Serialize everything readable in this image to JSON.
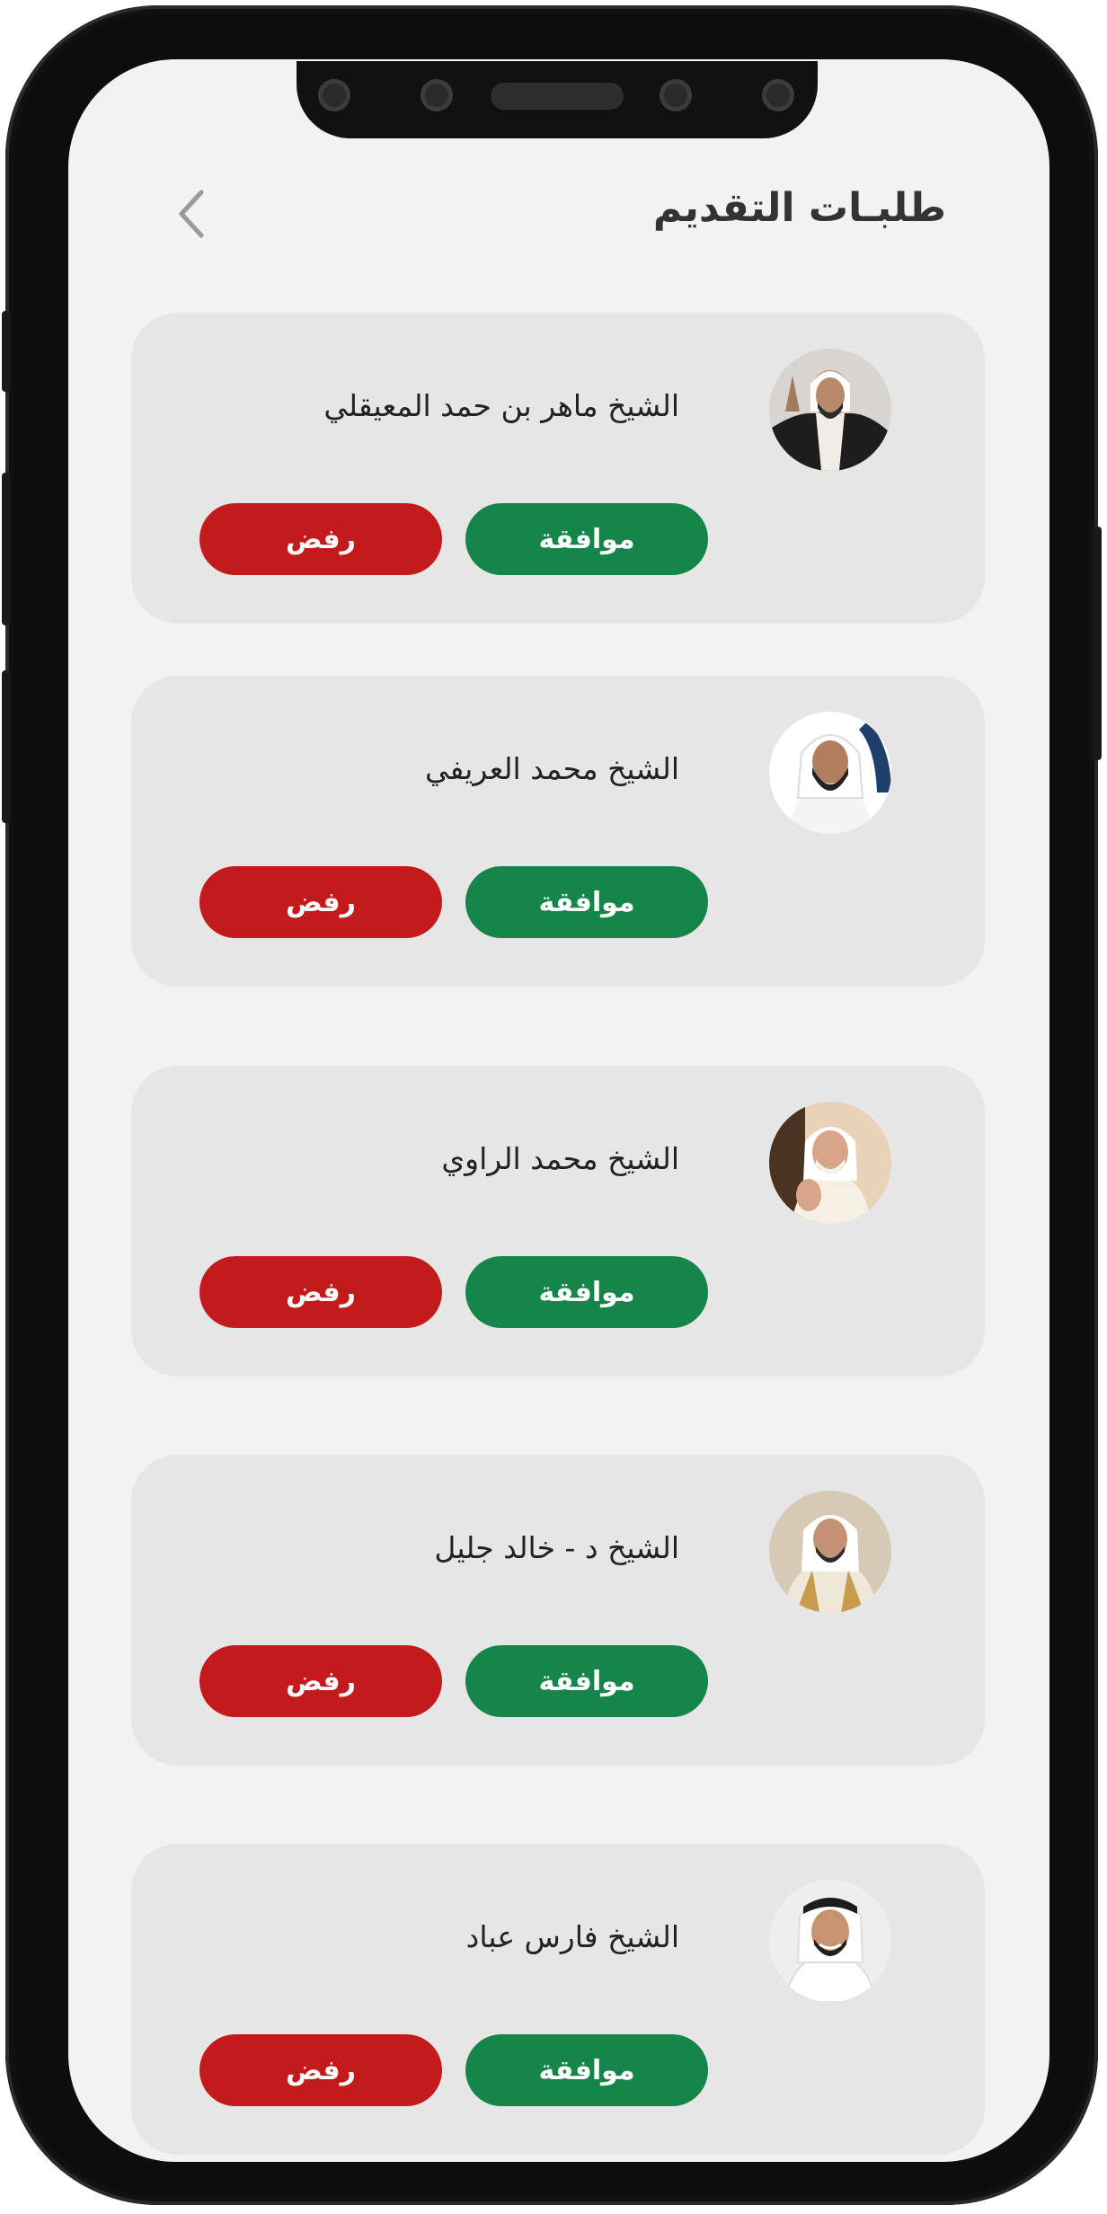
{
  "header": {
    "title": "طلبـات التقديم"
  },
  "colors": {
    "approve": "#16854a",
    "reject": "#c31a1c",
    "card": "#e6e6e6",
    "screen": "#f2f2f2"
  },
  "icons": {
    "back": "chevron-left-icon"
  },
  "requests": [
    {
      "name": "الشيخ ماهر بن حمد المعيقلي",
      "approve_label": "موافقة",
      "reject_label": "رفض"
    },
    {
      "name": "الشيخ محمد العريفي",
      "approve_label": "موافقة",
      "reject_label": "رفض"
    },
    {
      "name": "الشيخ محمد الراوي",
      "approve_label": "موافقة",
      "reject_label": "رفض"
    },
    {
      "name": "الشيخ  د - خالد جليل",
      "approve_label": "موافقة",
      "reject_label": "رفض"
    },
    {
      "name": "الشيخ فارس عباد",
      "approve_label": "موافقة",
      "reject_label": "رفض"
    }
  ]
}
